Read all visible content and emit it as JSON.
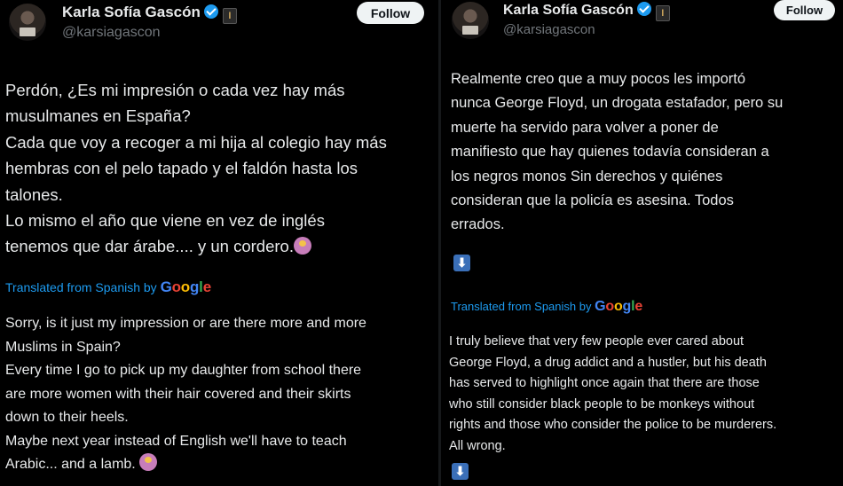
{
  "left": {
    "author": {
      "name": "Karla Sofía Gascón",
      "handle": "@karsiagascon"
    },
    "follow_label": "Follow",
    "original_text": "Perdón, ¿Es mi impresión o cada vez hay más\nmusulmanes en España?\nCada que voy a recoger a mi hija al colegio hay más\nhembras con el pelo tapado y el faldón hasta los\ntalones.\nLo mismo el año que viene en vez de inglés\ntenemos que dar árabe.... y un cordero.",
    "translated_label": "Translated from Spanish by",
    "translated_brand": "Google",
    "translation": "Sorry, is it just my impression or are there more and more\nMuslims in Spain?\nEvery time I go to pick up my daughter from school there\nare more women with their hair covered and their skirts\ndown to their heels.\nMaybe next year instead of English we'll have to teach\nArabic... and a lamb."
  },
  "right": {
    "author": {
      "name": "Karla Sofía Gascón",
      "handle": "@karsiagascon"
    },
    "follow_label": "Follow",
    "original_text": "Realmente creo que a muy pocos les importó\nnunca George Floyd, un drogata estafador, pero su\nmuerte ha servido para volver a poner de\nmanifiesto que hay quienes todavía consideran a\nlos negros monos Sin derechos y quiénes\nconsideran que la policía es asesina. Todos\nerrados.",
    "translated_label": "Translated from Spanish by",
    "translated_brand": "Google",
    "translation": "I truly believe that very few people ever cared about\nGeorge Floyd, a drug addict and a hustler, but his death\nhas served to highlight once again that there are those\nwho still consider black people to be monkeys without\nrights and those who consider the police to be murderers.\nAll wrong."
  },
  "icons": {
    "verified": "verified-badge-icon",
    "affiliate": "affiliate-badge-icon",
    "emoji": "person-shrugging-emoji",
    "arrow": "down-arrow-icon"
  },
  "colors": {
    "background": "#000000",
    "text": "#e7e9ea",
    "handle": "#71767b",
    "link": "#1d9bf0",
    "verified": "#1d9bf0"
  }
}
